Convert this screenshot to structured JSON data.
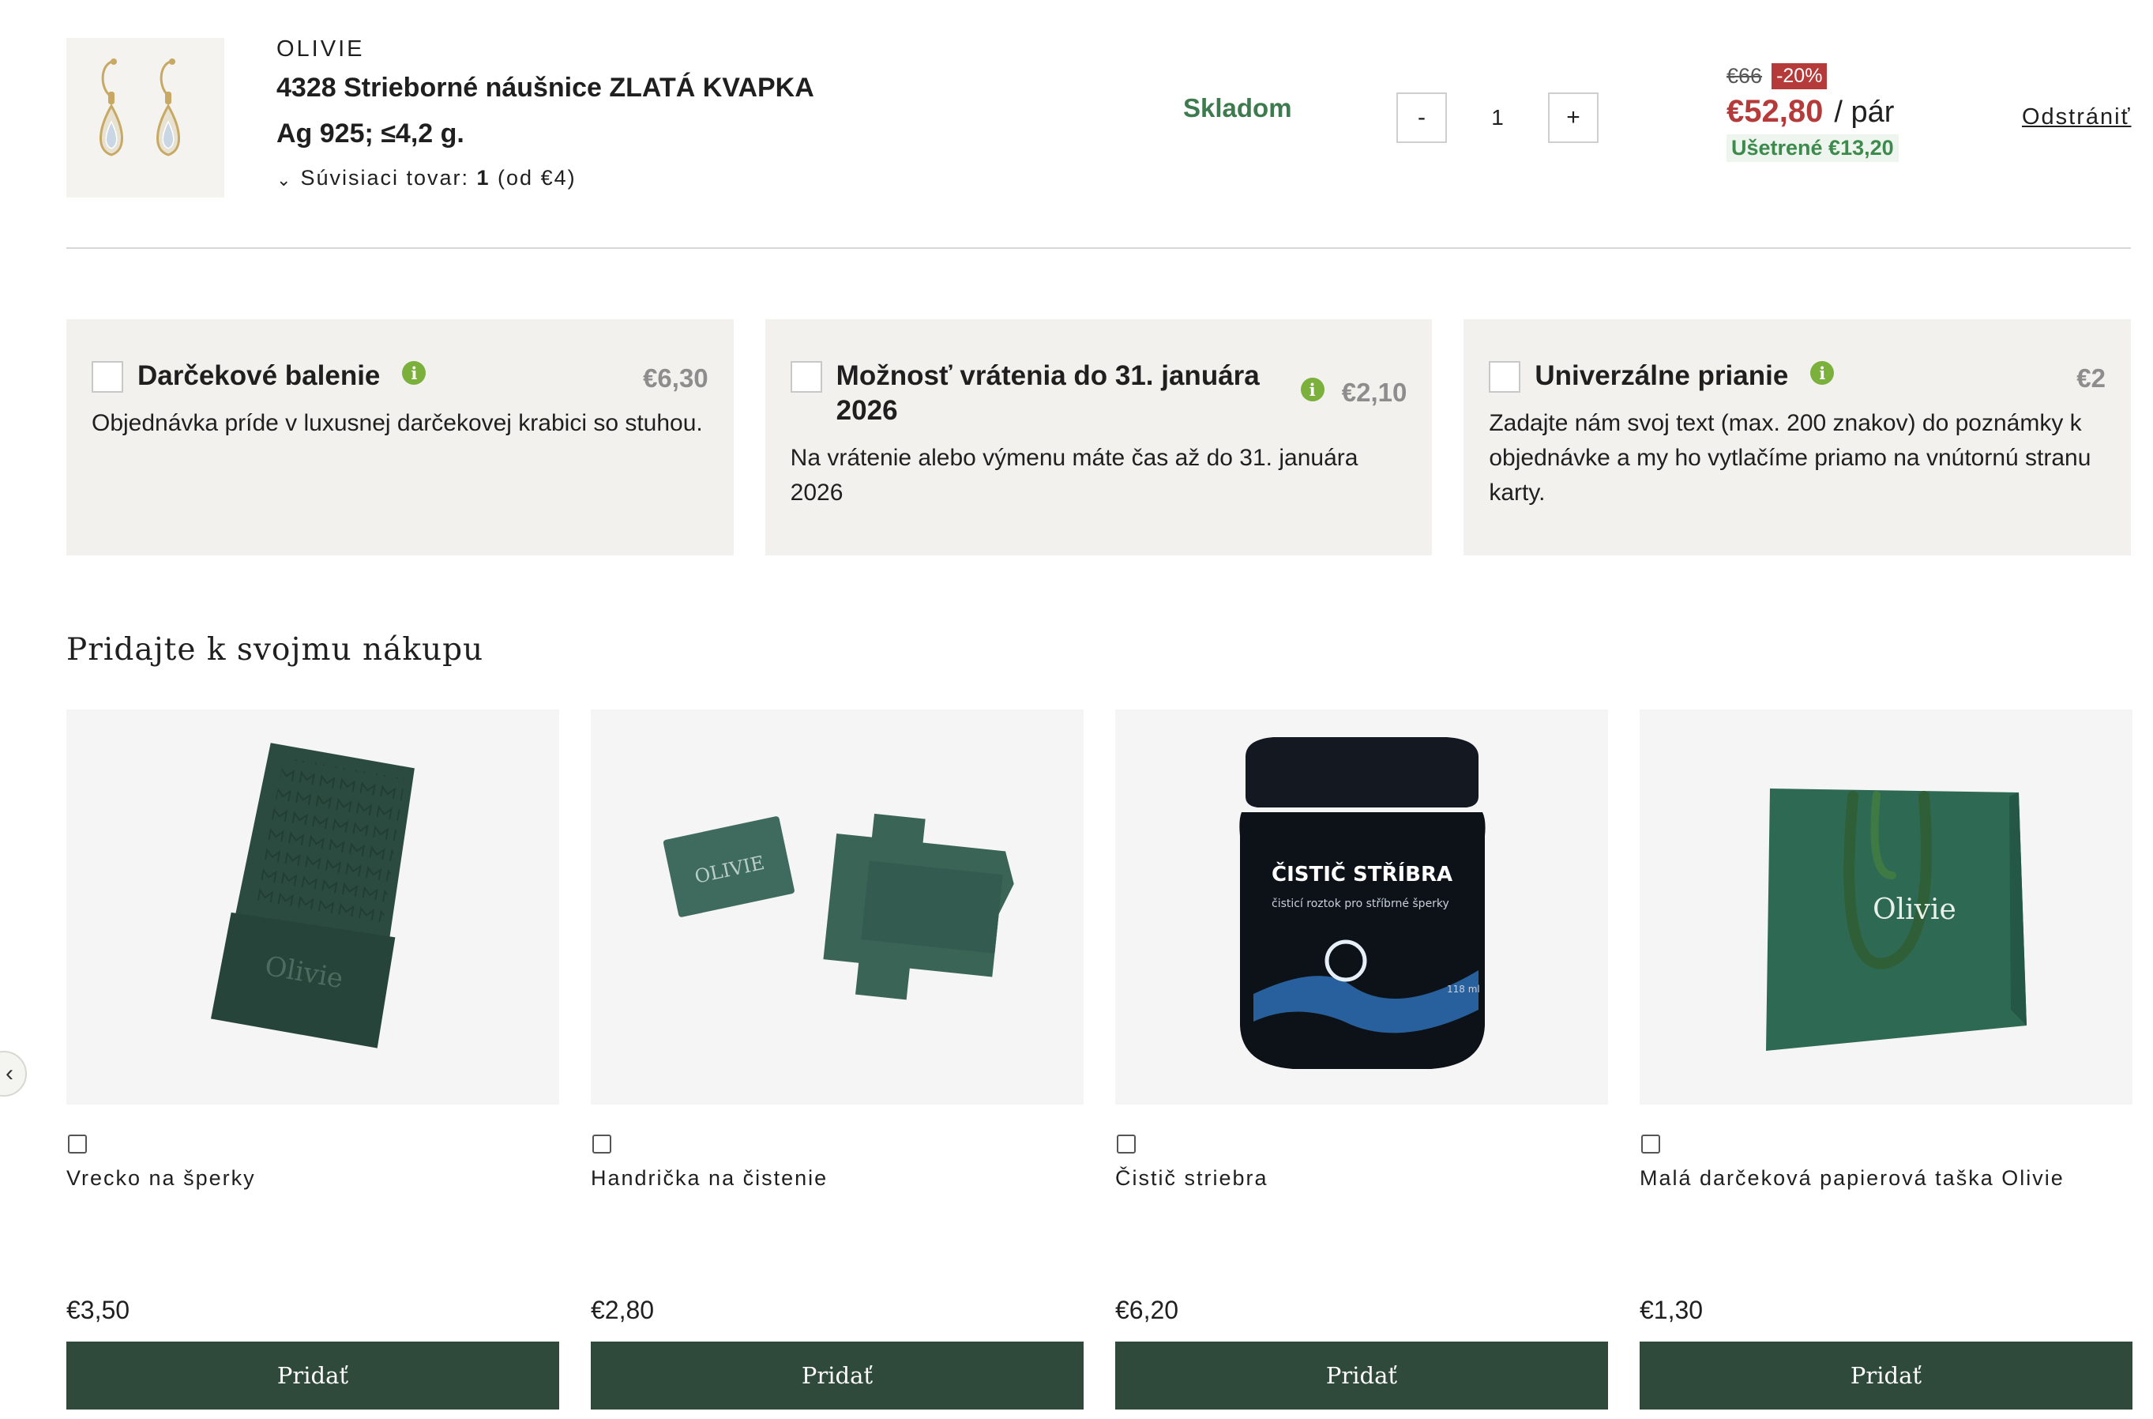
{
  "cart_item": {
    "brand": "OLIVIE",
    "name": "4328 Strieborné náušnice ZLATÁ KVAPKA",
    "spec": "Ag 925; ≤4,2 g.",
    "related_prefix": "Súvisiaci tovar: ",
    "related_count": "1",
    "related_suffix": " (od €4)",
    "stock": "Skladom",
    "qty_minus": "-",
    "qty_value": "1",
    "qty_plus": "+",
    "old_price": "€66",
    "discount": "-20%",
    "price": "€52,80",
    "unit": "/ pár",
    "saved": "Ušetrené €13,20",
    "remove": "Odstrániť"
  },
  "services": [
    {
      "title": "Darčekové balenie",
      "price": "€6,30",
      "desc": "Objednávka príde v luxusnej darčekovej krabici so stuhou."
    },
    {
      "title": "Možnosť vrátenia do 31. januára 2026",
      "price": "€2,10",
      "desc": "Na vrátenie alebo výmenu máte čas až do 31. januára 2026"
    },
    {
      "title": "Univerzálne prianie",
      "price": "€2",
      "desc": "Zadajte nám svoj text (max. 200 znakov) do poznámky k objednávke a my ho vytlačíme priamo na vnútornú stranu karty."
    }
  ],
  "info_glyph": "i",
  "upsell": {
    "title": "Pridajte k svojmu nákupu",
    "prev_glyph": "‹",
    "products": [
      {
        "name": "Vrecko na šperky",
        "price": "€3,50",
        "button": "Pridať"
      },
      {
        "name": "Handrička na čistenie",
        "price": "€2,80",
        "button": "Pridať"
      },
      {
        "name": "Čistič striebra",
        "price": "€6,20",
        "button": "Pridať"
      },
      {
        "name": "Malá darčeková papierová taška Olivie",
        "price": "€1,30",
        "button": "Pridať"
      }
    ],
    "image_text": {
      "pouch_logo": "Olivie",
      "cloth_logo": "OLIVIE",
      "cleaner_title": "ČISTIČ STŘÍBRA",
      "cleaner_sub": "čisticí roztok pro stříbrné šperky",
      "cleaner_volume": "118 ml",
      "bag_logo": "Olivie"
    }
  },
  "colors": {
    "accent_green": "#2f4a3a",
    "stock_green": "#3d7a4d",
    "sale_red": "#b53b3b",
    "info_green": "#7ab03b",
    "panel_bg": "#f2f1ee"
  }
}
